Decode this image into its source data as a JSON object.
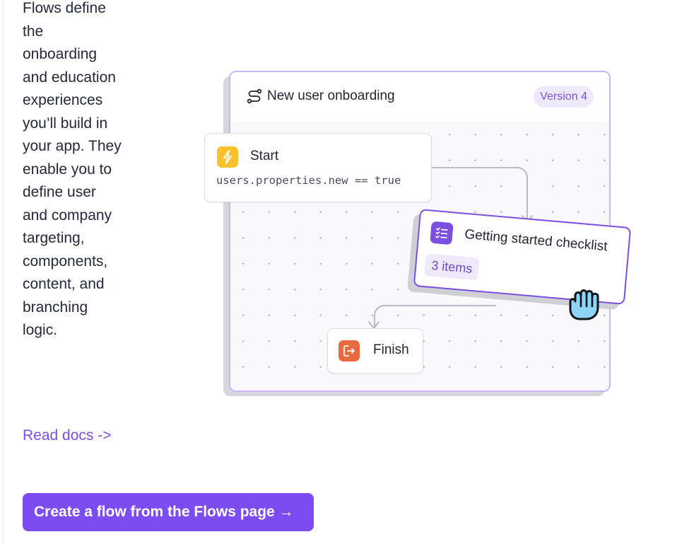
{
  "intro": {
    "description": "Flows define the onboarding and education experiences you’ll build in your app. They enable you to define user and company targeting, components, content, and branching logic.",
    "read_docs_link": "Read docs ->",
    "cta_button": "Create a flow from the Flows page →"
  },
  "flow_preview": {
    "title": "New user onboarding",
    "version_badge": "Version 4",
    "nodes": {
      "start": {
        "label": "Start",
        "condition": "users.properties.new == true",
        "icon": "lightning-icon"
      },
      "checklist": {
        "label": "Getting started checklist",
        "items_badge": "3 items",
        "icon": "checklist-icon"
      },
      "finish": {
        "label": "Finish",
        "icon": "exit-icon"
      }
    },
    "cursor_icon": "grab-hand-icon"
  },
  "colors": {
    "accent": "#7d4cf0",
    "link": "#7a4fe0",
    "start_icon": "#fbc02d",
    "finish_icon": "#ea6a3d",
    "checklist_icon": "#7b4fe0",
    "hand_fill": "#8fd3f7"
  }
}
